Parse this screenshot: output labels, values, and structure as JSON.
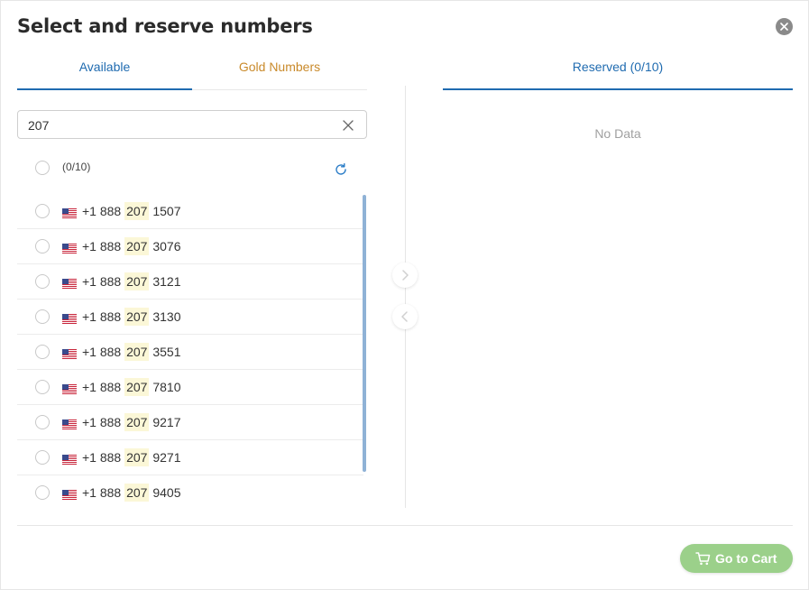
{
  "dialog": {
    "title": "Select and reserve numbers",
    "close_icon": "close-icon"
  },
  "left": {
    "tabs": [
      {
        "label": "Available",
        "active": true
      },
      {
        "label": "Gold Numbers",
        "active": false
      }
    ],
    "search": {
      "value": "207",
      "clear_icon": "clear-icon"
    },
    "select_count": "(0/10)",
    "refresh_icon": "refresh-icon",
    "numbers": [
      {
        "prefix": "+1 888 ",
        "match": "207",
        "suffix": " 1507"
      },
      {
        "prefix": "+1 888 ",
        "match": "207",
        "suffix": " 3076"
      },
      {
        "prefix": "+1 888 ",
        "match": "207",
        "suffix": " 3121"
      },
      {
        "prefix": "+1 888 ",
        "match": "207",
        "suffix": " 3130"
      },
      {
        "prefix": "+1 888 ",
        "match": "207",
        "suffix": " 3551"
      },
      {
        "prefix": "+1 888 ",
        "match": "207",
        "suffix": " 7810"
      },
      {
        "prefix": "+1 888 ",
        "match": "207",
        "suffix": " 9217"
      },
      {
        "prefix": "+1 888 ",
        "match": "207",
        "suffix": " 9271"
      },
      {
        "prefix": "+1 888 ",
        "match": "207",
        "suffix": " 9405"
      }
    ]
  },
  "transfer": {
    "right_icon": "chevron-right-icon",
    "left_icon": "chevron-left-icon"
  },
  "right": {
    "tab_label": "Reserved (0/10)",
    "empty_text": "No Data"
  },
  "footer": {
    "cart_label": "Go to Cart",
    "cart_icon": "cart-icon"
  },
  "colors": {
    "accent": "#1f6bb0",
    "gold": "#c98a2b",
    "cart_button": "#9bd08a",
    "highlight": "#fbf7d7"
  }
}
